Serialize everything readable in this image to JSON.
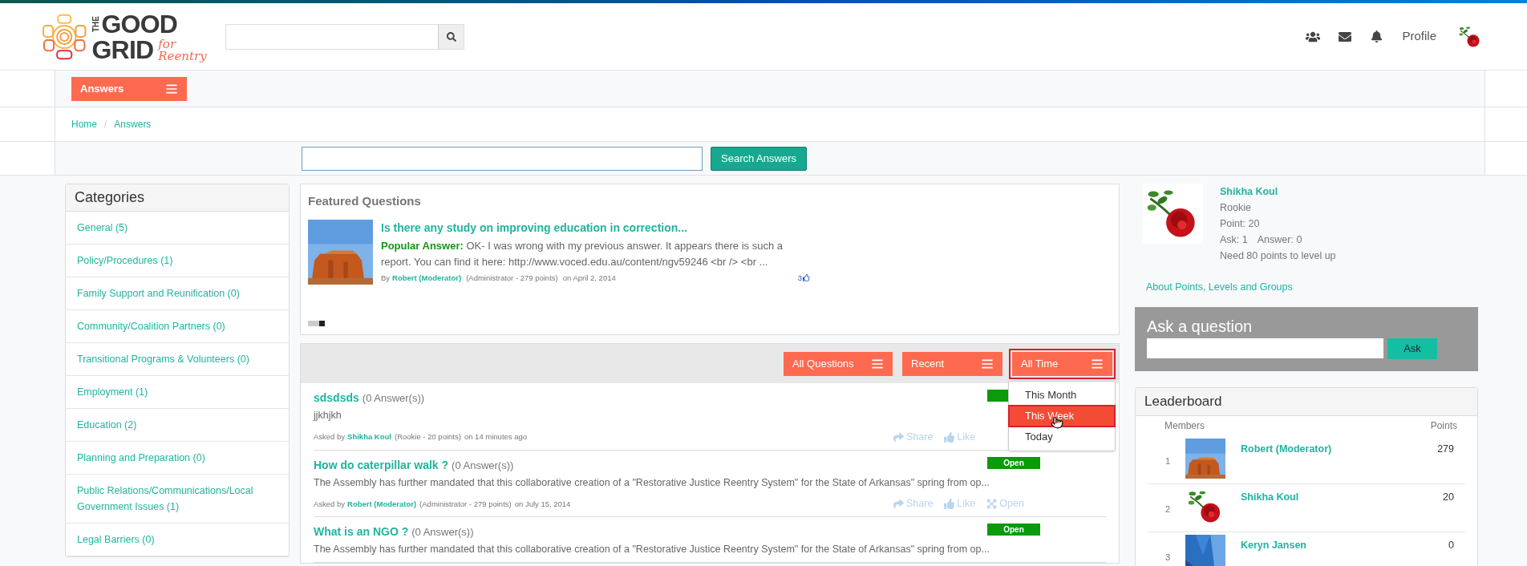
{
  "logo": {
    "the": "THE",
    "good": "GOOD",
    "grid": "GRID",
    "tagline": "for Reentry"
  },
  "header": {
    "profile": "Profile"
  },
  "nav": {
    "menu_button": "Answers"
  },
  "breadcrumb": {
    "separator": "/",
    "items": [
      {
        "label": "Home"
      },
      {
        "label": "Answers"
      }
    ]
  },
  "answer_search": {
    "button": "Search Answers"
  },
  "categories": {
    "title": "Categories",
    "items": [
      {
        "label": "General (5)"
      },
      {
        "label": "Policy/Procedures (1)"
      },
      {
        "label": "Family Support and Reunification (0)"
      },
      {
        "label": "Community/Coalition Partners (0)"
      },
      {
        "label": "Transitional Programs & Volunteers (0)"
      },
      {
        "label": "Employment (1)"
      },
      {
        "label": "Education (2)"
      },
      {
        "label": "Planning and Preparation (0)"
      },
      {
        "label": "Public Relations/Communications/Local Government Issues (1)"
      },
      {
        "label": "Legal Barriers (0)"
      }
    ]
  },
  "featured": {
    "title": "Featured Questions",
    "items": [
      {
        "title": "Is there any study on improving education in correction...",
        "answer_label": "Popular Answer:",
        "answer_text": "OK- I was wrong with my previous answer. It appears there is such a report. You can find it here: http://www.voced.edu.au/content/ngv59246 <br /> <br ...",
        "by": "By",
        "author": "Robert (Moderator)",
        "role": "(Administrator - 279 points)",
        "date": "on April 2, 2014",
        "likes": "3"
      }
    ],
    "slides": [
      {
        "selected": false
      },
      {
        "selected": false
      },
      {
        "selected": true
      }
    ]
  },
  "filters": [
    {
      "label": "All Questions",
      "highlighted": false
    },
    {
      "label": "Recent",
      "highlighted": false
    },
    {
      "label": "All Time",
      "highlighted": true
    }
  ],
  "filter_menu": {
    "items": [
      {
        "label": "This Month",
        "selected": false
      },
      {
        "label": "This Week",
        "selected": true
      },
      {
        "label": "Today",
        "selected": false
      }
    ]
  },
  "questions": [
    {
      "title": "sdsdsds",
      "answers": "(0 Answer(s))",
      "description": "jjkhjkh",
      "asked_by": "Asked by",
      "author": "Shikha Koul",
      "role": "(Rookie - 20 points)",
      "date": "on 14 minutes ago",
      "badge_covered": true,
      "actions": [
        {
          "kind": "share",
          "label": "Share"
        },
        {
          "kind": "like",
          "label": "Like"
        }
      ]
    },
    {
      "title": "How do caterpillar walk ?",
      "answers": "(0 Answer(s))",
      "description": "The Assembly has further mandated that this collaborative creation of a \"Restorative Justice Reentry System\" for the State of Arkansas\" spring from op...",
      "asked_by": "Asked by",
      "author": "Robert (Moderator)",
      "role": "(Administrator - 279 points)",
      "date": "on July 15, 2014",
      "status": "Open",
      "actions": [
        {
          "kind": "share",
          "label": "Share"
        },
        {
          "kind": "like",
          "label": "Like"
        },
        {
          "kind": "open",
          "label": "Open"
        }
      ]
    },
    {
      "title": "What is an NGO ?",
      "answers": "(0 Answer(s))",
      "description": "The Assembly has further mandated that this collaborative creation of a \"Restorative Justice Reentry System\" for the State of Arkansas\" spring from op...",
      "status": "Open"
    }
  ],
  "profile": {
    "name": "Shikha Koul",
    "level": "Rookie",
    "points": "Point: 20",
    "asks": "Ask: 1",
    "answers": "Answer: 0",
    "next": "Need 80 points to level up",
    "about_link": "About Points, Levels and Groups"
  },
  "ask": {
    "title": "Ask a question",
    "button": "Ask"
  },
  "leaderboard": {
    "title": "Leaderboard",
    "members_header": "Members",
    "points_header": "Points",
    "rows": [
      {
        "rank": "1",
        "name": "Robert (Moderator)",
        "points": "279"
      },
      {
        "rank": "2",
        "name": "Shikha Koul",
        "points": "20"
      },
      {
        "rank": "3",
        "name": "Keryn Jansen",
        "points": "0"
      }
    ]
  }
}
